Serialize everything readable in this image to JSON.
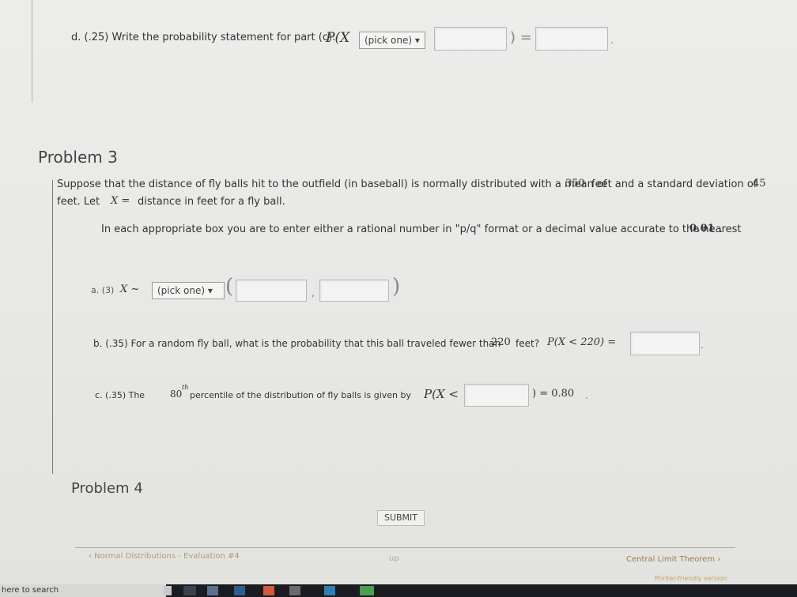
{
  "part_d": {
    "label": "d. (.25)  Write the probability statement for part (c):",
    "prefix": "P(X",
    "select_value": "(pick one) ▾",
    "equals": ")  =",
    "period": "."
  },
  "problem3": {
    "title": "Problem 3",
    "statement_1": "Suppose that the distance of fly balls hit to the outfield (in baseball) is normally distributed with a mean of",
    "mean": "350",
    "statement_2": "feet and a standard deviation of",
    "sd": "45",
    "statement_3a": "feet. Let",
    "variable": "X =",
    "statement_3b": "distance in feet for a fly ball.",
    "instruction": "In each appropriate box you are to enter either a rational number in \"p/q\" format or a decimal value accurate to the nearest",
    "precision": "0.01",
    "instruction_end": ".",
    "part_a": {
      "label": "a. (3)",
      "dist": "X ~",
      "select_value": "(pick one) ▾",
      "comma": ","
    },
    "part_b": {
      "label": "b. (.35)  For a random fly ball, what is the probability that this ball traveled fewer than",
      "value": "220",
      "unit": "feet?",
      "expr": "P(X < 220) =",
      "period": "."
    },
    "part_c": {
      "label": "c. (.35)  The",
      "percentile": "80",
      "sup": "th",
      "label_2": "percentile of the distribution of fly balls is given by",
      "expr": "P(X <",
      "result": ")  = 0.80",
      "period": "."
    }
  },
  "problem4": {
    "title": "Problem 4"
  },
  "submit_label": "SUBMIT",
  "nav": {
    "prev": "‹ Normal Distributions - Evaluation #4",
    "up": "up",
    "next": "Central Limit Theorem ›",
    "printer": "Printer-friendly version"
  },
  "taskbar": {
    "search": "here to search"
  }
}
